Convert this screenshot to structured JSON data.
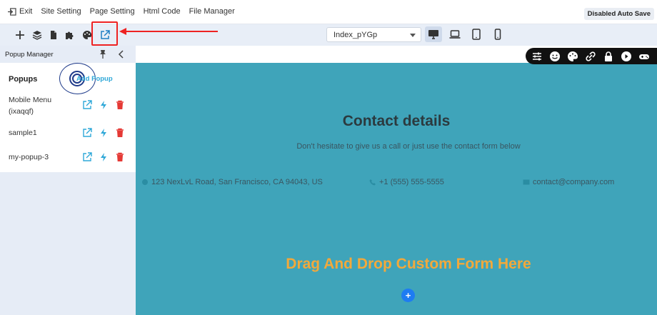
{
  "topbar": {
    "menu": [
      "Exit",
      "Site Setting",
      "Page Setting",
      "Html Code",
      "File Manager"
    ],
    "autosave": "Disabled Auto Save"
  },
  "toolbar": {
    "tools": [
      "plus-icon",
      "layers-icon",
      "document-icon",
      "puzzle-icon",
      "palette-icon",
      "external-link-icon"
    ],
    "page_select": "Index_pYGp",
    "devices": [
      "desktop-icon",
      "laptop-icon",
      "tablet-icon",
      "phone-icon"
    ]
  },
  "panel": {
    "title": "Popup Manager",
    "popups_label": "Popups",
    "add_popup": "Add Popup",
    "items": [
      {
        "name": "Mobile Menu (ixaqqf)"
      },
      {
        "name": "sample1"
      },
      {
        "name": "my-popup-3"
      }
    ]
  },
  "canvas": {
    "title": "Contact details",
    "subtitle": "Don't hesitate to give us a call or just use the contact form below",
    "address": "123 NexLvL Road, San Francisco, CA 94043, US",
    "phone": "+1 (555) 555-5555",
    "email": "contact@company.com",
    "dnd": "Drag And Drop Custom Form Here",
    "plus": "+"
  },
  "colors": {
    "section_bg": "#3fa4ba",
    "accent_orange": "#f2a93b",
    "link_blue": "#2fa8d8",
    "delete_red": "#e53935",
    "highlight_red": "#e22222"
  }
}
